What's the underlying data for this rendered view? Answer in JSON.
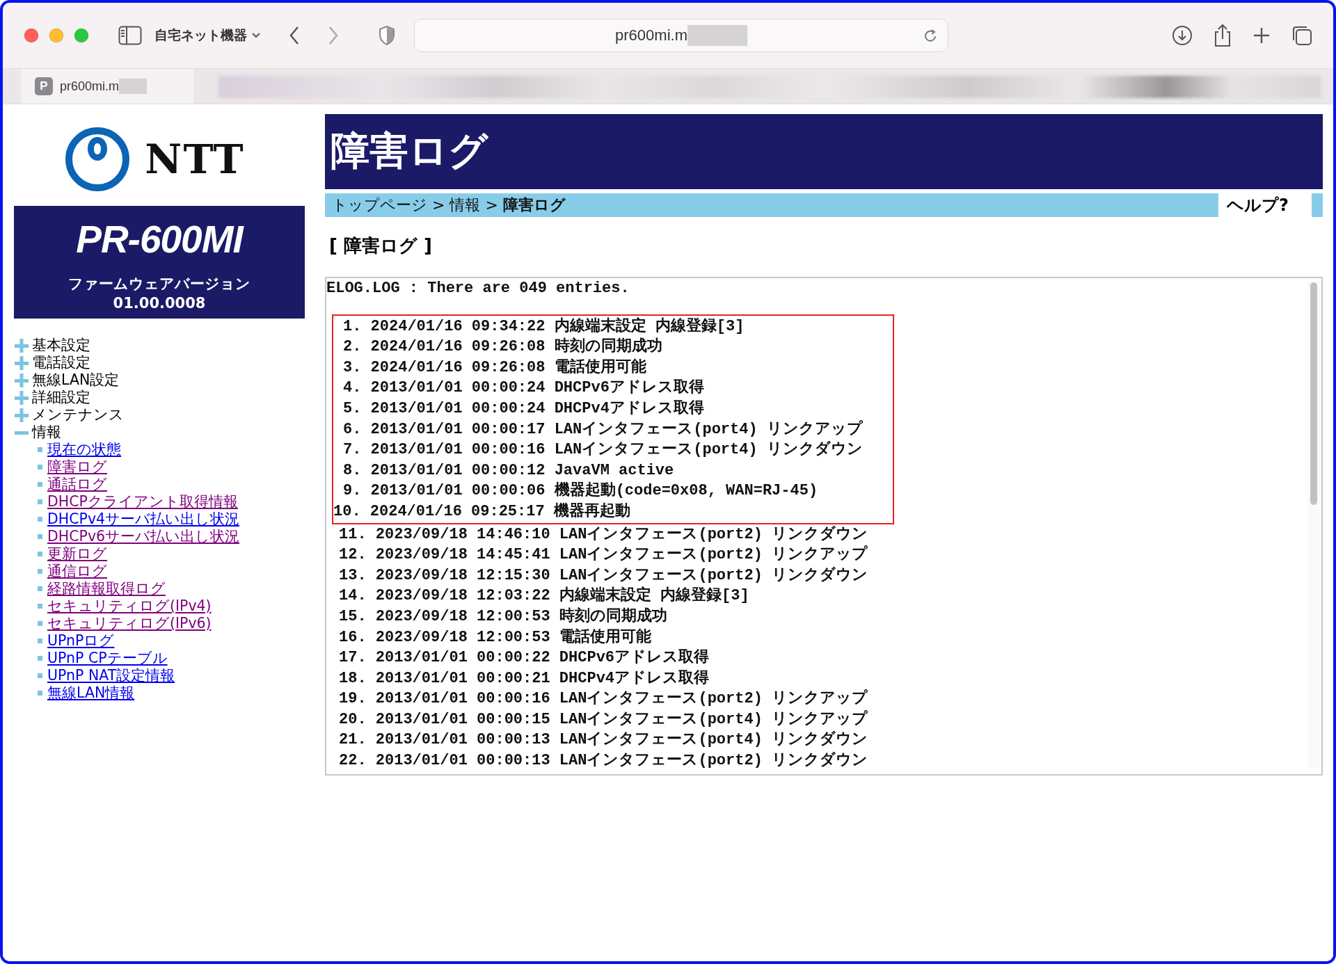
{
  "browser": {
    "window_title": "自宅ネット機器",
    "address": "pr600mi.m",
    "tab": {
      "favicon_letter": "P",
      "title": "pr600mi.m"
    }
  },
  "sidebar": {
    "brand": "NTT",
    "model": "PR-600MI",
    "firmware_label": "ファームウェアバージョン",
    "firmware_version": "01.00.0008",
    "menu": [
      {
        "label": "基本設定",
        "expanded": false
      },
      {
        "label": "電話設定",
        "expanded": false
      },
      {
        "label": "無線LAN設定",
        "expanded": false
      },
      {
        "label": "詳細設定",
        "expanded": false
      },
      {
        "label": "メンテナンス",
        "expanded": false
      },
      {
        "label": "情報",
        "expanded": true,
        "children": [
          {
            "label": "現在の状態",
            "visited": false
          },
          {
            "label": "障害ログ",
            "visited": true
          },
          {
            "label": "通話ログ",
            "visited": true
          },
          {
            "label": "DHCPクライアント取得情報",
            "visited": true
          },
          {
            "label": "DHCPv4サーバ払い出し状況",
            "visited": false
          },
          {
            "label": "DHCPv6サーバ払い出し状況",
            "visited": true
          },
          {
            "label": "更新ログ",
            "visited": true
          },
          {
            "label": "通信ログ",
            "visited": true
          },
          {
            "label": "経路情報取得ログ",
            "visited": true
          },
          {
            "label": "セキュリティログ(IPv4)",
            "visited": true
          },
          {
            "label": "セキュリティログ(IPv6)",
            "visited": true
          },
          {
            "label": "UPnPログ",
            "visited": false
          },
          {
            "label": "UPnP CPテーブル",
            "visited": false
          },
          {
            "label": "UPnP NAT設定情報",
            "visited": false
          },
          {
            "label": "無線LAN情報",
            "visited": false
          }
        ]
      }
    ]
  },
  "page": {
    "title": "障害ログ",
    "breadcrumb": "トップページ > 情報 > **障害ログ**",
    "help": "ヘルプ?",
    "section_heading": "[ 障害ログ ]",
    "log": {
      "summary": "ELOG.LOG : There are 049 entries.",
      "highlighted_entries": [
        "1. 2024/01/16 09:34:22 内線端末設定 内線登録[3]",
        "2. 2024/01/16 09:26:08 時刻の同期成功",
        "3. 2024/01/16 09:26:08 電話使用可能",
        "4. 2013/01/01 00:00:24 DHCPv6アドレス取得",
        "5. 2013/01/01 00:00:24 DHCPv4アドレス取得",
        "6. 2013/01/01 00:00:17 LANインタフェース(port4) リンクアップ",
        "7. 2013/01/01 00:00:16 LANインタフェース(port4) リンクダウン",
        "8. 2013/01/01 00:00:12 JavaVM active",
        "9. 2013/01/01 00:00:06 機器起動(code=0x08, WAN=RJ-45)",
        "10. 2024/01/16 09:25:17 機器再起動"
      ],
      "entries": [
        "11. 2023/09/18 14:46:10 LANインタフェース(port2) リンクダウン",
        "12. 2023/09/18 14:45:41 LANインタフェース(port2) リンクアップ",
        "13. 2023/09/18 12:15:30 LANインタフェース(port2) リンクダウン",
        "14. 2023/09/18 12:03:22 内線端末設定 内線登録[3]",
        "15. 2023/09/18 12:00:53 時刻の同期成功",
        "16. 2023/09/18 12:00:53 電話使用可能",
        "17. 2013/01/01 00:00:22 DHCPv6アドレス取得",
        "18. 2013/01/01 00:00:21 DHCPv4アドレス取得",
        "19. 2013/01/01 00:00:16 LANインタフェース(port2) リンクアップ",
        "20. 2013/01/01 00:00:15 LANインタフェース(port4) リンクアップ",
        "21. 2013/01/01 00:00:13 LANインタフェース(port4) リンクダウン",
        "22. 2013/01/01 00:00:13 LANインタフェース(port2) リンクダウン"
      ]
    }
  }
}
